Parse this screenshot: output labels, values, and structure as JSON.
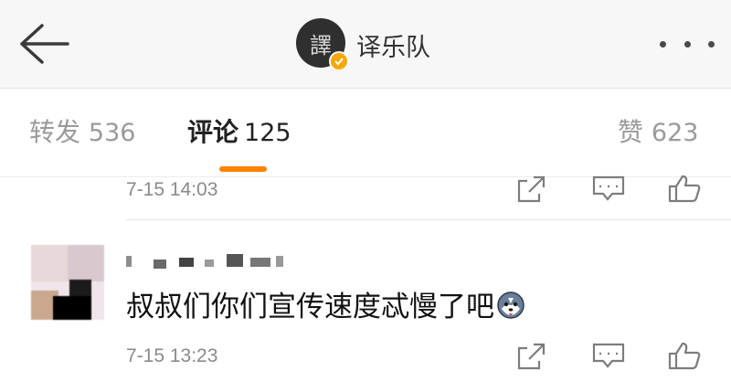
{
  "header": {
    "account_name": "译乐队",
    "avatar_glyph": "譯"
  },
  "tabs": {
    "repost": {
      "label": "转发",
      "count": "536"
    },
    "comment": {
      "label": "评论",
      "count": "125"
    },
    "like": {
      "label": "赞",
      "count": "623"
    },
    "active": "comment",
    "accent_color": "#ff8200"
  },
  "comments": [
    {
      "time": "7-15 14:03"
    },
    {
      "text": "叔叔们你们宣传速度忒慢了吧",
      "time": "7-15 13:23",
      "emoji": "husky-emoji"
    }
  ],
  "icons": [
    "back-arrow-icon",
    "verified-badge-icon",
    "more-dots-icon",
    "share-icon",
    "comment-icon",
    "like-icon"
  ]
}
